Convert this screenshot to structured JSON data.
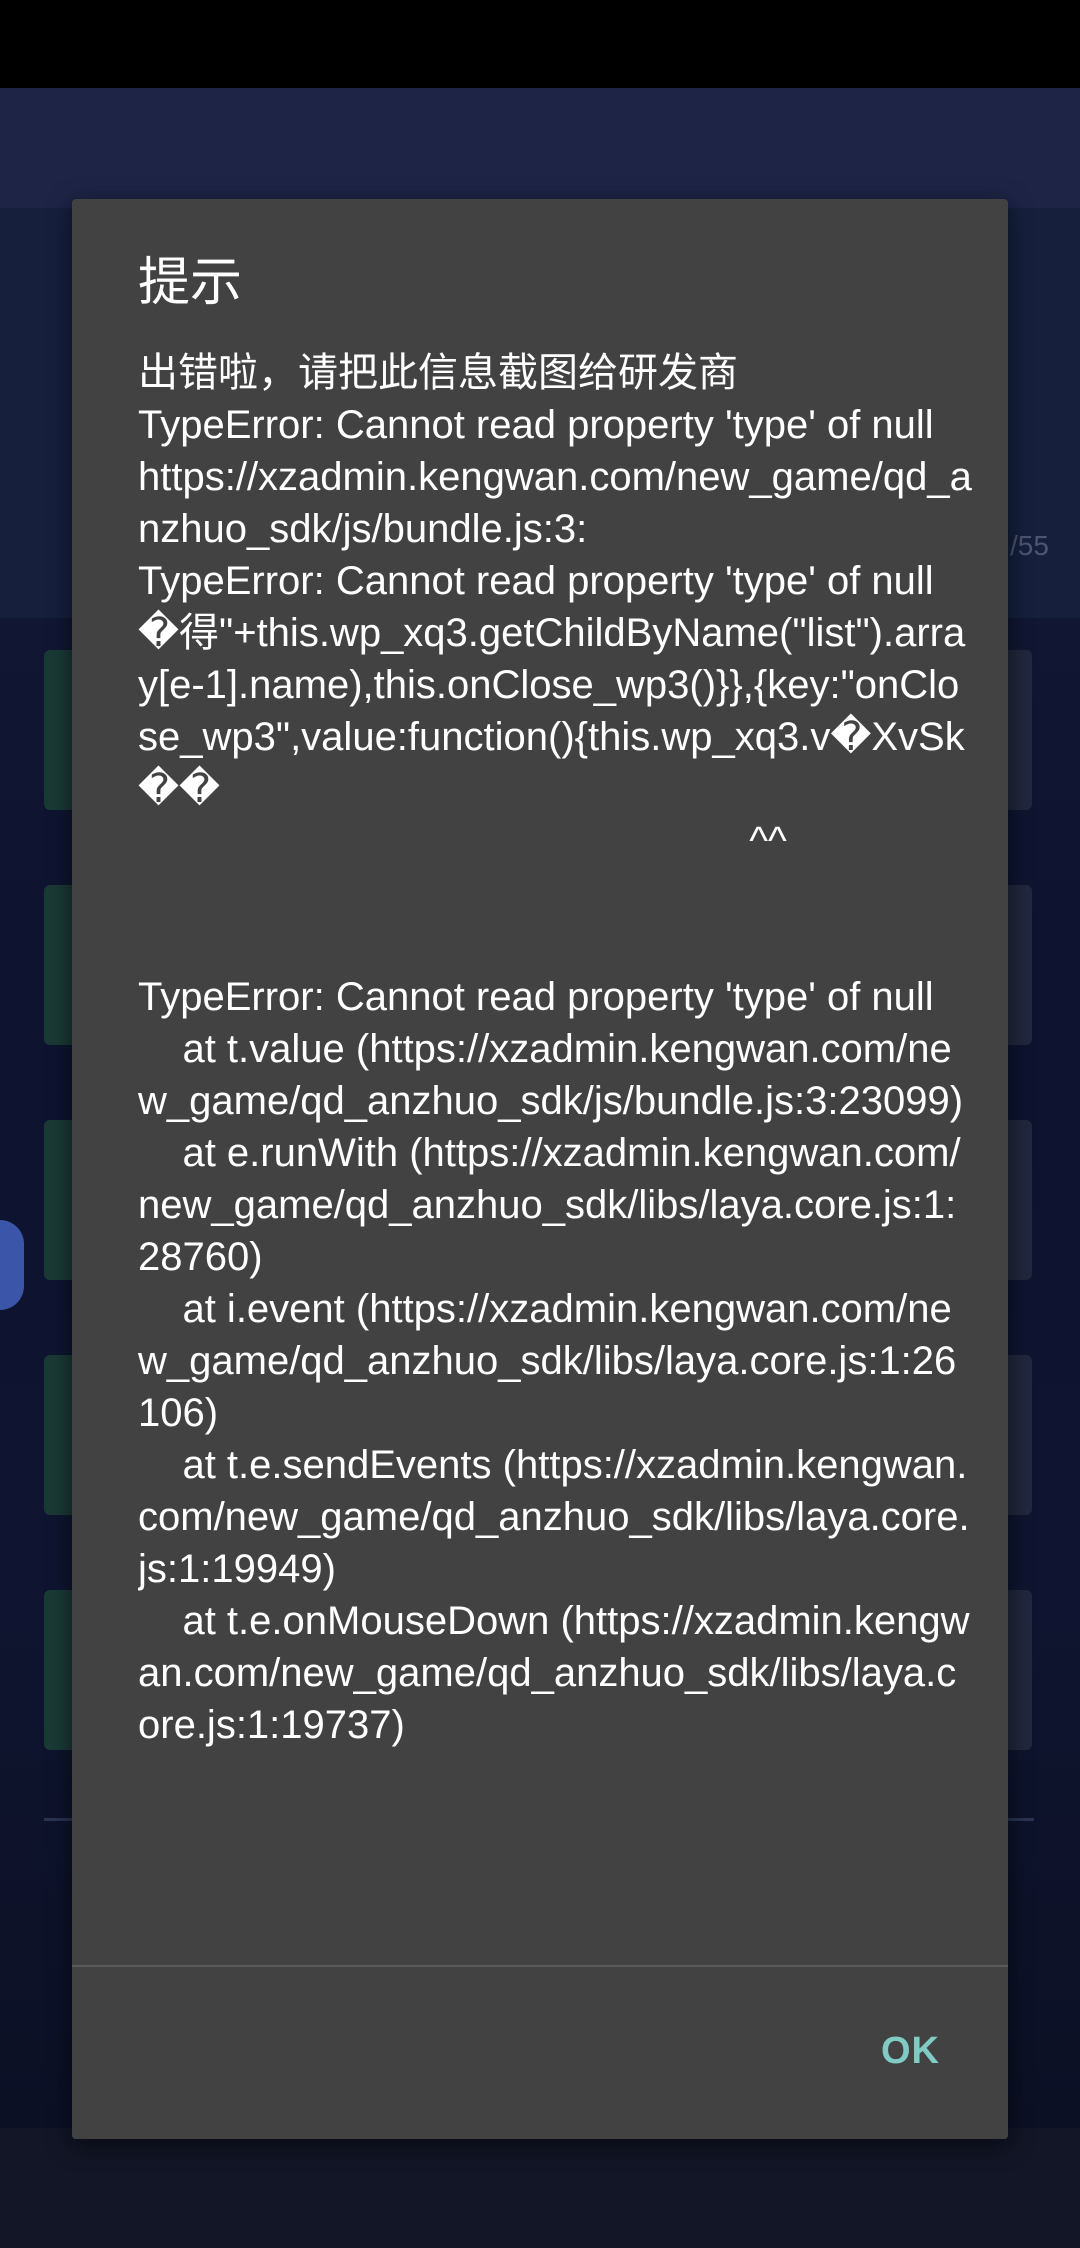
{
  "dialog": {
    "title": "提示",
    "message": "出错啦，请把此信息截图给研发商\nTypeError: Cannot read property 'type' of null\nhttps://xzadmin.kengwan.com/new_game/qd_anzhuo_sdk/js/bundle.js:3:\nTypeError: Cannot read property 'type' of null\n�得\"+this.wp_xq3.getChildByName(\"list\").array[e-1].name),this.onClose_wp3()}},{key:\"onClose_wp3\",value:function(){this.wp_xq3.v�XvSk��\n                                                       ^^\n\n\nTypeError: Cannot read property 'type' of null\n    at t.value (https://xzadmin.kengwan.com/new_game/qd_anzhuo_sdk/js/bundle.js:3:23099)\n    at e.runWith (https://xzadmin.kengwan.com/new_game/qd_anzhuo_sdk/libs/laya.core.js:1:28760)\n    at i.event (https://xzadmin.kengwan.com/new_game/qd_anzhuo_sdk/libs/laya.core.js:1:26106)\n    at t.e.sendEvents (https://xzadmin.kengwan.com/new_game/qd_anzhuo_sdk/libs/laya.core.js:1:19949)\n    at t.e.onMouseDown (https://xzadmin.kengwan.com/new_game/qd_anzhuo_sdk/libs/laya.core.js:1:19737)",
    "ok_label": "OK"
  },
  "background": {
    "count_text": "/55"
  },
  "colors": {
    "dialog_bg": "#424242",
    "accent": "#80cbc4",
    "text": "#ffffff"
  }
}
